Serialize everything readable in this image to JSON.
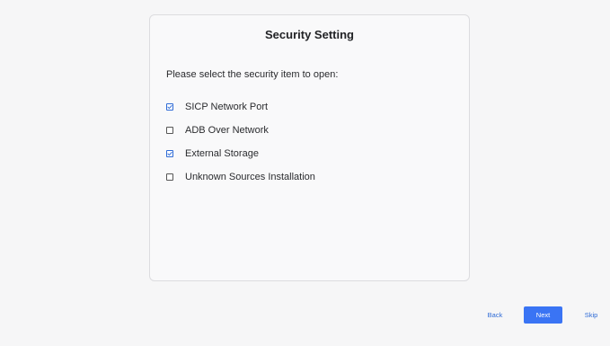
{
  "dialog": {
    "title": "Security Setting",
    "prompt": "Please select the security item to open:",
    "options": [
      {
        "label": "SICP Network Port",
        "checked": true
      },
      {
        "label": "ADB Over Network",
        "checked": false
      },
      {
        "label": "External Storage",
        "checked": true
      },
      {
        "label": "Unknown Sources Installation",
        "checked": false
      }
    ]
  },
  "footer": {
    "back_label": "Back",
    "next_label": "Next",
    "skip_label": "Skip"
  },
  "colors": {
    "accent": "#3a74f4",
    "check_accent": "#2f6bd6"
  }
}
